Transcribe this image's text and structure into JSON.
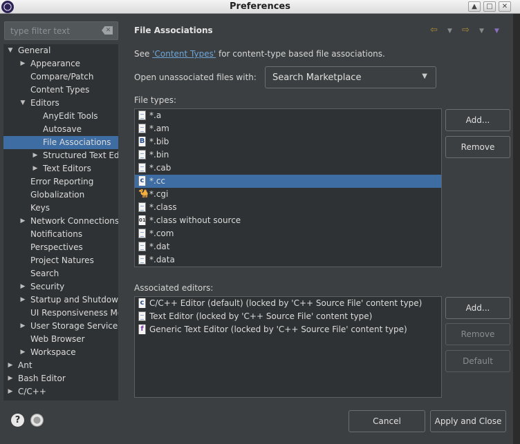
{
  "window": {
    "title": "Preferences"
  },
  "filter": {
    "placeholder": "type filter text"
  },
  "tree": [
    {
      "label": "General",
      "level": 0,
      "state": "expanded"
    },
    {
      "label": "Appearance",
      "level": 1,
      "state": "collapsed"
    },
    {
      "label": "Compare/Patch",
      "level": 1,
      "state": "leaf"
    },
    {
      "label": "Content Types",
      "level": 1,
      "state": "leaf"
    },
    {
      "label": "Editors",
      "level": 1,
      "state": "expanded"
    },
    {
      "label": "AnyEdit Tools",
      "level": 2,
      "state": "leaf"
    },
    {
      "label": "Autosave",
      "level": 2,
      "state": "leaf"
    },
    {
      "label": "File Associations",
      "level": 2,
      "state": "leaf",
      "selected": true
    },
    {
      "label": "Structured Text Editors",
      "level": 2,
      "state": "collapsed"
    },
    {
      "label": "Text Editors",
      "level": 2,
      "state": "collapsed"
    },
    {
      "label": "Error Reporting",
      "level": 1,
      "state": "leaf"
    },
    {
      "label": "Globalization",
      "level": 1,
      "state": "leaf"
    },
    {
      "label": "Keys",
      "level": 1,
      "state": "leaf"
    },
    {
      "label": "Network Connections",
      "level": 1,
      "state": "collapsed"
    },
    {
      "label": "Notifications",
      "level": 1,
      "state": "leaf"
    },
    {
      "label": "Perspectives",
      "level": 1,
      "state": "leaf"
    },
    {
      "label": "Project Natures",
      "level": 1,
      "state": "leaf"
    },
    {
      "label": "Search",
      "level": 1,
      "state": "leaf"
    },
    {
      "label": "Security",
      "level": 1,
      "state": "collapsed"
    },
    {
      "label": "Startup and Shutdown",
      "level": 1,
      "state": "collapsed"
    },
    {
      "label": "UI Responsiveness Monitoring",
      "level": 1,
      "state": "leaf"
    },
    {
      "label": "User Storage Service",
      "level": 1,
      "state": "collapsed"
    },
    {
      "label": "Web Browser",
      "level": 1,
      "state": "leaf"
    },
    {
      "label": "Workspace",
      "level": 1,
      "state": "collapsed"
    },
    {
      "label": "Ant",
      "level": 0,
      "state": "collapsed"
    },
    {
      "label": "Bash Editor",
      "level": 0,
      "state": "collapsed"
    },
    {
      "label": "C/C++",
      "level": 0,
      "state": "collapsed"
    }
  ],
  "page": {
    "title": "File Associations",
    "see_prefix": "See ",
    "see_link": "'Content Types'",
    "see_suffix": " for content-type based file associations.",
    "open_label": "Open unassociated files with:",
    "open_value": "Search Marketplace",
    "file_types_label": "File types:",
    "file_types": [
      {
        "name": "*.a",
        "icon": "file-icon"
      },
      {
        "name": "*.am",
        "icon": "file-icon"
      },
      {
        "name": "*.bib",
        "icon": "bib-file-icon"
      },
      {
        "name": "*.bin",
        "icon": "file-icon"
      },
      {
        "name": "*.cab",
        "icon": "file-icon"
      },
      {
        "name": "*.cc",
        "icon": "cpp-file-icon",
        "selected": true
      },
      {
        "name": "*.cgi",
        "icon": "camel-icon"
      },
      {
        "name": "*.class",
        "icon": "file-icon"
      },
      {
        "name": "*.class without source",
        "icon": "class-file-icon"
      },
      {
        "name": "*.com",
        "icon": "file-icon"
      },
      {
        "name": "*.dat",
        "icon": "file-icon"
      },
      {
        "name": "*.data",
        "icon": "file-icon"
      }
    ],
    "associated_label": "Associated editors:",
    "associated_editors": [
      {
        "name": "C/C++ Editor (default) (locked by 'C++ Source File' content type)",
        "icon": "cpp-file-icon"
      },
      {
        "name": "Text Editor (locked by 'C++ Source File' content type)",
        "icon": "file-icon"
      },
      {
        "name": "Generic Text Editor (locked by 'C++ Source File' content type)",
        "icon": "generic-editor-icon"
      }
    ],
    "buttons": {
      "add_types": "Add...",
      "remove_types": "Remove",
      "add_editors": "Add...",
      "remove_editors": "Remove",
      "default": "Default"
    }
  },
  "footer": {
    "cancel": "Cancel",
    "apply_close": "Apply and Close"
  },
  "colors": {
    "background": "#3c3f41",
    "list_bg": "#2f3234",
    "selection": "#3d6da3",
    "link": "#6ea6d8"
  }
}
